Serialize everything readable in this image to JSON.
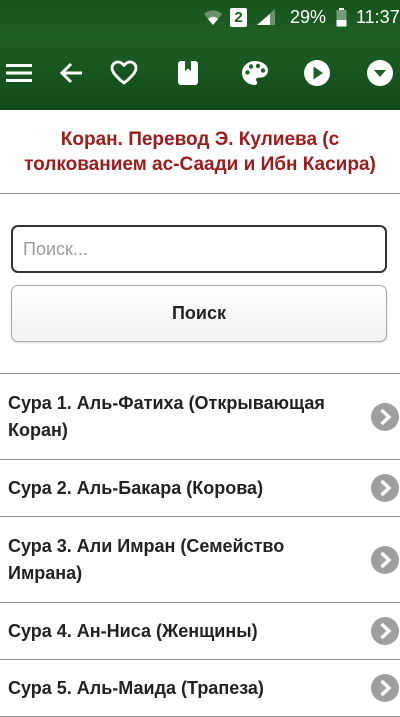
{
  "status_bar": {
    "sim_badge": "2",
    "battery": "29%",
    "time": "11:37"
  },
  "toolbar": {
    "icons": [
      "menu-icon",
      "back-arrow-icon",
      "heart-icon",
      "bookmark-icon",
      "palette-icon",
      "play-icon",
      "dropdown-icon"
    ]
  },
  "header": {
    "title": "Коран. Перевод Э. Кулиева (с толкованием ас-Саади и Ибн Касира)"
  },
  "search": {
    "placeholder": "Поиск...",
    "button_label": "Поиск"
  },
  "suras": [
    {
      "label": "Сура 1. Аль-Фатиха (Открывающая Коран)"
    },
    {
      "label": "Сура 2. Аль-Бакара (Корова)"
    },
    {
      "label": "Сура 3. Али Имран (Семейство Имрана)"
    },
    {
      "label": "Сура 4. Ан-Ниса (Женщины)"
    },
    {
      "label": "Сура 5. Аль-Маида (Трапеза)"
    }
  ],
  "colors": {
    "toolbar": "#1b5e20",
    "title": "#9b1c1c",
    "chevron": "#9e9e9e"
  }
}
